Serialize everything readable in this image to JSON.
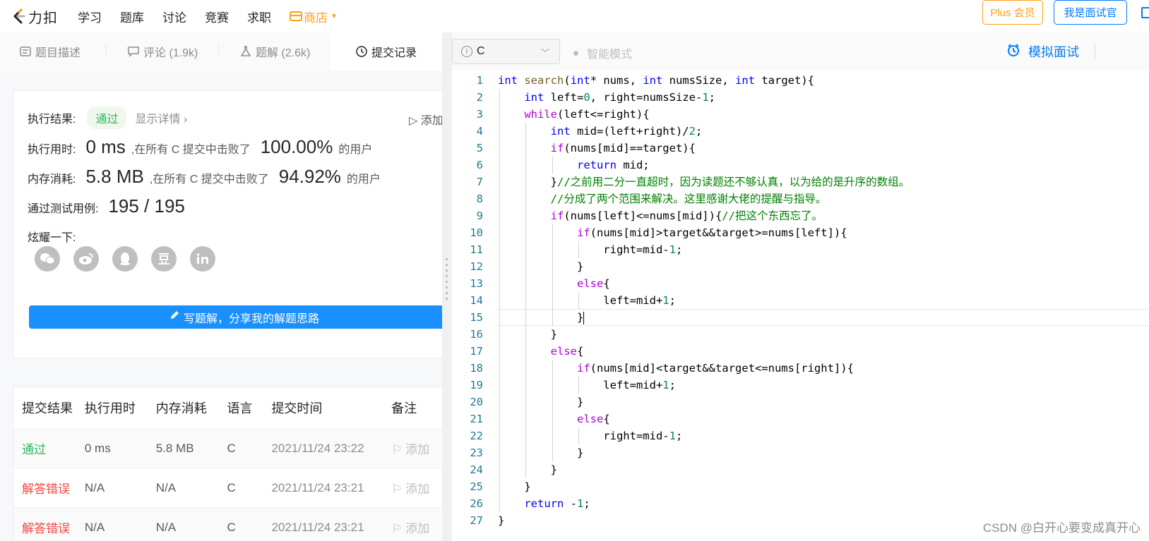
{
  "nav": {
    "logo_text": "力扣",
    "items": [
      "学习",
      "题库",
      "讨论",
      "竞赛",
      "求职"
    ],
    "shop": "商店",
    "plus": "Plus 会员",
    "interviewer": "我是面试官"
  },
  "tabs": [
    {
      "label": "题目描述",
      "icon": "description-icon"
    },
    {
      "label": "评论 (1.9k)",
      "icon": "comment-icon"
    },
    {
      "label": "题解 (2.6k)",
      "icon": "flask-icon"
    },
    {
      "label": "提交记录",
      "icon": "clock-icon"
    }
  ],
  "result": {
    "status_label": "执行结果:",
    "status": "通过",
    "detail": "显示详情 ›",
    "add_note": "添加备",
    "time_label": "执行用时:",
    "time_value": "0 ms",
    "time_text": ",在所有 C 提交中击败了",
    "time_pct": "100.00%",
    "time_suffix": "的用户",
    "mem_label": "内存消耗:",
    "mem_value": "5.8 MB",
    "mem_text": ",在所有 C 提交中击败了",
    "mem_pct": "94.92%",
    "mem_suffix": "的用户",
    "tests_label": "通过测试用例:",
    "tests_value": "195 / 195",
    "share_label": "炫耀一下:",
    "share_icons": [
      "wechat-icon",
      "weibo-icon",
      "qq-icon",
      "douban-icon",
      "linkedin-icon"
    ],
    "write_btn": "写题解，分享我的解题思路"
  },
  "submissions": {
    "headers": [
      "提交结果",
      "执行用时",
      "内存消耗",
      "语言",
      "提交时间",
      "备注"
    ],
    "rows": [
      {
        "result": "通过",
        "time": "0 ms",
        "memory": "5.8 MB",
        "lang": "C",
        "submitted": "2021/11/24 23:22",
        "note": "添加"
      },
      {
        "result": "解答错误",
        "time": "N/A",
        "memory": "N/A",
        "lang": "C",
        "submitted": "2021/11/24 23:21",
        "note": "添加"
      },
      {
        "result": "解答错误",
        "time": "N/A",
        "memory": "N/A",
        "lang": "C",
        "submitted": "2021/11/24 23:21",
        "note": "添加"
      }
    ]
  },
  "editor": {
    "language": "C",
    "smart_mode": "智能模式",
    "mock_interview": "模拟面试",
    "current_line": 15,
    "lines": [
      "int search(int* nums, int numsSize, int target){",
      "    int left=0, right=numsSize-1;",
      "    while(left<=right){",
      "        int mid=(left+right)/2;",
      "        if(nums[mid]==target){",
      "            return mid;",
      "        }//之前用二分一直超时，因为读题还不够认真，以为给的是升序的数组。",
      "        //分成了两个范围来解决。这里感谢大佬的提醒与指导。",
      "        if(nums[left]<=nums[mid]){//把这个东西忘了。",
      "            if(nums[mid]>target&&target>=nums[left]){",
      "                right=mid-1;",
      "            }",
      "            else{",
      "                left=mid+1;",
      "            }",
      "        }",
      "        else{",
      "            if(nums[mid]<target&&target<=nums[right]){",
      "                left=mid+1;",
      "            }",
      "            else{",
      "                right=mid-1;",
      "            }",
      "        }",
      "    }",
      "    return -1;",
      "}"
    ]
  },
  "watermark": "CSDN @白开心要变成真开心",
  "colors": {
    "accent": "#007aff",
    "orange": "#ffa116",
    "pass": "#2db55d",
    "error": "#ef4743"
  }
}
